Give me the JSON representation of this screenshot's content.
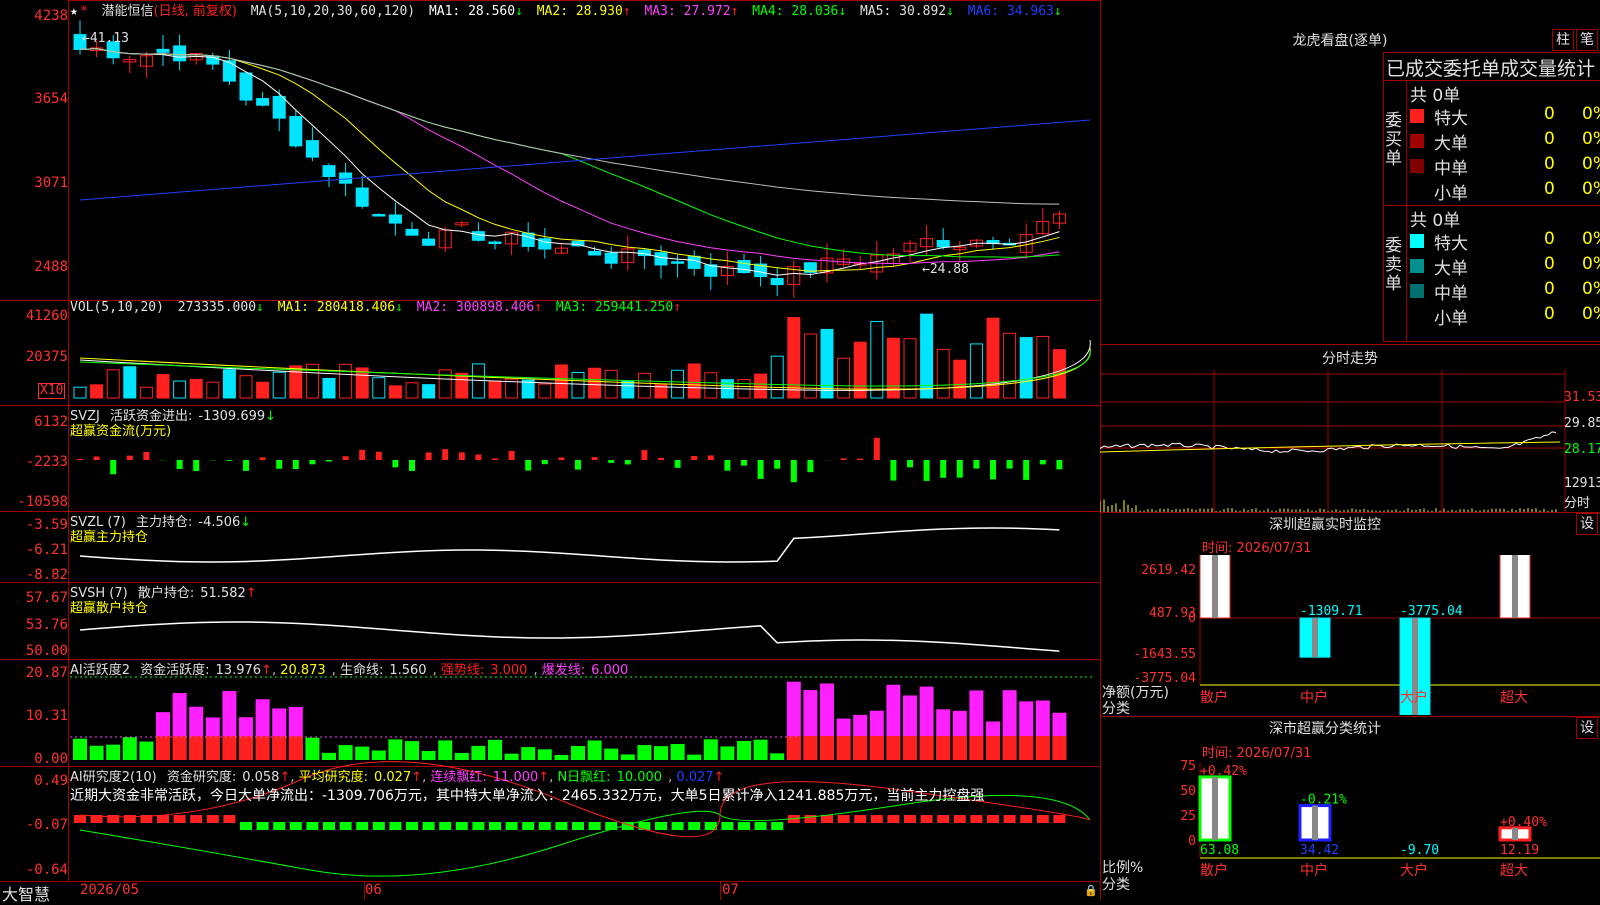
{
  "app": {
    "brand": "大智慧"
  },
  "stock": {
    "name": "潜能恒信",
    "mode": "(日线, 前复权)"
  },
  "colors": {
    "up": "#ff2020",
    "down": "#00e5ff",
    "grid": "#a00000",
    "axis": "#ff3030",
    "ma1": "#ffffff",
    "ma2": "#ffff00",
    "ma3": "#ff40ff",
    "ma4": "#00ff00",
    "ma5": "#c0c0c0",
    "ma6": "#2040ff"
  },
  "main_chart": {
    "ma_title": "MA(5,10,20,30,60,120)",
    "ma": [
      {
        "label": "MA1:",
        "value": "28.560",
        "arrow": "↓"
      },
      {
        "label": "MA2:",
        "value": "28.930",
        "arrow": "↑"
      },
      {
        "label": "MA3:",
        "value": "27.972",
        "arrow": "↑"
      },
      {
        "label": "MA4:",
        "value": "28.036",
        "arrow": "↓"
      },
      {
        "label": "MA5:",
        "value": "30.892",
        "arrow": "↓"
      },
      {
        "label": "MA6:",
        "value": "34.963",
        "arrow": "↓"
      }
    ],
    "y_labels": [
      "4238",
      "3654",
      "3071",
      "2488"
    ],
    "high_marker": "41.13",
    "low_marker": "←24.88"
  },
  "volume": {
    "title": "VOL(5,10,20)",
    "value": "273335.000",
    "value_arrow": "↓",
    "ma": [
      {
        "label": "MA1:",
        "value": "280418.406",
        "arrow": "↓"
      },
      {
        "label": "MA2:",
        "value": "300898.406",
        "arrow": "↑"
      },
      {
        "label": "MA3:",
        "value": "259441.250",
        "arrow": "↑"
      }
    ],
    "y_labels": [
      "41260",
      "20375"
    ],
    "unit": "X10"
  },
  "svzj": {
    "title": "SVZJ",
    "label": "活跃资金进出:",
    "value": "-1309.699",
    "arrow": "↓",
    "subtitle": "超赢资金流(万元)",
    "y_labels": [
      "6132",
      "-2233",
      "-10598"
    ]
  },
  "svzl": {
    "title": "SVZL (7)",
    "label": "主力持仓:",
    "value": "-4.506",
    "arrow": "↓",
    "subtitle": "超赢主力持仓",
    "y_labels": [
      "-3.59",
      "-6.21",
      "-8.82"
    ]
  },
  "svsh": {
    "title": "SVSH (7)",
    "label": "散户持仓:",
    "value": "51.582",
    "arrow": "↑",
    "subtitle": "超赢散户持仓",
    "y_labels": [
      "57.67",
      "53.76",
      "50.00"
    ]
  },
  "ai_active": {
    "title": "AI活跃度2",
    "label": "资金活跃度:",
    "value": "13.976",
    "arrow": "↑",
    "v2": "20.873",
    "life_label": "生命线:",
    "life": "1.560",
    "strong_label": "强势线:",
    "strong": "3.000",
    "burst_label": "爆发线:",
    "burst": "6.000",
    "y_labels": [
      "20.87",
      "10.31",
      "0.00"
    ]
  },
  "ai_research": {
    "title": "AI研究度2(10)",
    "label": "资金研究度:",
    "value": "0.058",
    "arrow": "↑",
    "avg_label": "平均研究度:",
    "avg": "0.027",
    "avg_arrow": "↑",
    "streak_label": "连续飘红:",
    "streak": "11.000",
    "streak_arrow": "↑",
    "nday_label": "N日飘红:",
    "nday": "10.000",
    "v": "0.027",
    "v_arrow": "↑",
    "summary": "近期大资金非常活跃，今日大单净流出：-1309.706万元，其中特大单净流入：2465.332万元，大单5日累计净入1241.885万元，当前主力控盘强",
    "y_labels": [
      "0.49",
      "-0.07",
      "-0.64"
    ]
  },
  "x_axis": {
    "labels": [
      "2026/05",
      "06",
      "07"
    ]
  },
  "lhb": {
    "title": "龙虎看盘(逐单)",
    "btn1": "柱",
    "btn2": "笔",
    "header": "已成交委托单成交量统计",
    "buy_label": "委买单",
    "sell_label": "委卖单",
    "buy_total": "共 0单",
    "sell_total": "共 0单",
    "buy_rows": [
      {
        "name": "特大",
        "count": "0",
        "pct": "0%",
        "color": "#ff2020"
      },
      {
        "name": "大单",
        "count": "0",
        "pct": "0%",
        "color": "#a00000"
      },
      {
        "name": "中单",
        "count": "0",
        "pct": "0%",
        "color": "#800000"
      },
      {
        "name": "小单",
        "count": "0",
        "pct": "0%",
        "color": "#000000"
      }
    ],
    "sell_rows": [
      {
        "name": "特大",
        "count": "0",
        "pct": "0%",
        "color": "#00ffff"
      },
      {
        "name": "大单",
        "count": "0",
        "pct": "0%",
        "color": "#009090"
      },
      {
        "name": "中单",
        "count": "0",
        "pct": "0%",
        "color": "#007070"
      },
      {
        "name": "小单",
        "count": "0",
        "pct": "0%",
        "color": "#000000"
      }
    ]
  },
  "intraday": {
    "title": "分时走势",
    "y_labels": [
      "31.53",
      "29.85",
      "28.17"
    ],
    "vol_label": "12913",
    "vol_unit": "分时"
  },
  "sz_monitor": {
    "title": "深圳超赢实时监控",
    "btn": "设",
    "time": "时间: 2026/07/31",
    "y_labels": [
      "2619.42",
      "487.93",
      "0",
      "-1643.55",
      "-3775.04"
    ],
    "y_title_1": "净额(万元)",
    "y_title_2": "分类",
    "bars": [
      {
        "cat": "散户",
        "value": 2619.42,
        "label": "2619.42"
      },
      {
        "cat": "中户",
        "value": -1309.71,
        "label": "-1309.71"
      },
      {
        "cat": "大户",
        "value": -3775.04,
        "label": "-3775.04"
      },
      {
        "cat": "超大",
        "value": 2465.33,
        "label": "2465.33"
      }
    ]
  },
  "sz_class": {
    "title": "深市超赢分类统计",
    "btn": "设",
    "time": "时间: 2026/07/31",
    "y_labels": [
      "75",
      "50",
      "25",
      "0"
    ],
    "y_title_1": "比例%",
    "y_title_2": "分类",
    "bars": [
      {
        "cat": "散户",
        "value": 63.08,
        "label": "63.08",
        "change": "+0.42%"
      },
      {
        "cat": "中户",
        "value": 34.42,
        "label": "34.42",
        "change": "-0.21%"
      },
      {
        "cat": "大户",
        "value": -9.7,
        "label": "-9.70",
        "change": ""
      },
      {
        "cat": "超大",
        "value": 12.19,
        "label": "12.19",
        "change": "+0.40%"
      }
    ]
  }
}
